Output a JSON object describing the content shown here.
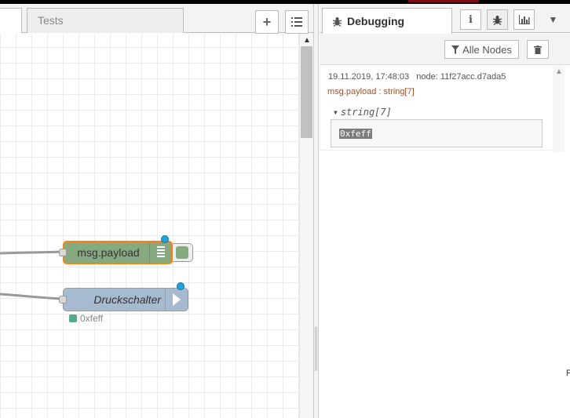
{
  "workspace": {
    "tab": "Tests",
    "add_button": "+",
    "list_button": "☰"
  },
  "flow": {
    "debug_node": {
      "label": "msg.payload"
    },
    "inject_node": {
      "label": "Druckschalter",
      "status": "0xfeff"
    }
  },
  "sidebar": {
    "tab_label": "Debugging",
    "info_icon": "i",
    "filter_button": "Alle Nodes",
    "message": {
      "timestamp": "19.11.2019, 17:48:03",
      "node": "node: 11f27acc.d7ada5",
      "topic": "msg.payload : string[7]",
      "type": "string[7]",
      "value": "0xfeff"
    }
  },
  "colors": {
    "debug_node": "#87a980",
    "inject_node": "#a6bbcf",
    "selected_outline": "#ff7f0e",
    "change_dot": "#1fa2e0"
  },
  "edge_text": "F"
}
